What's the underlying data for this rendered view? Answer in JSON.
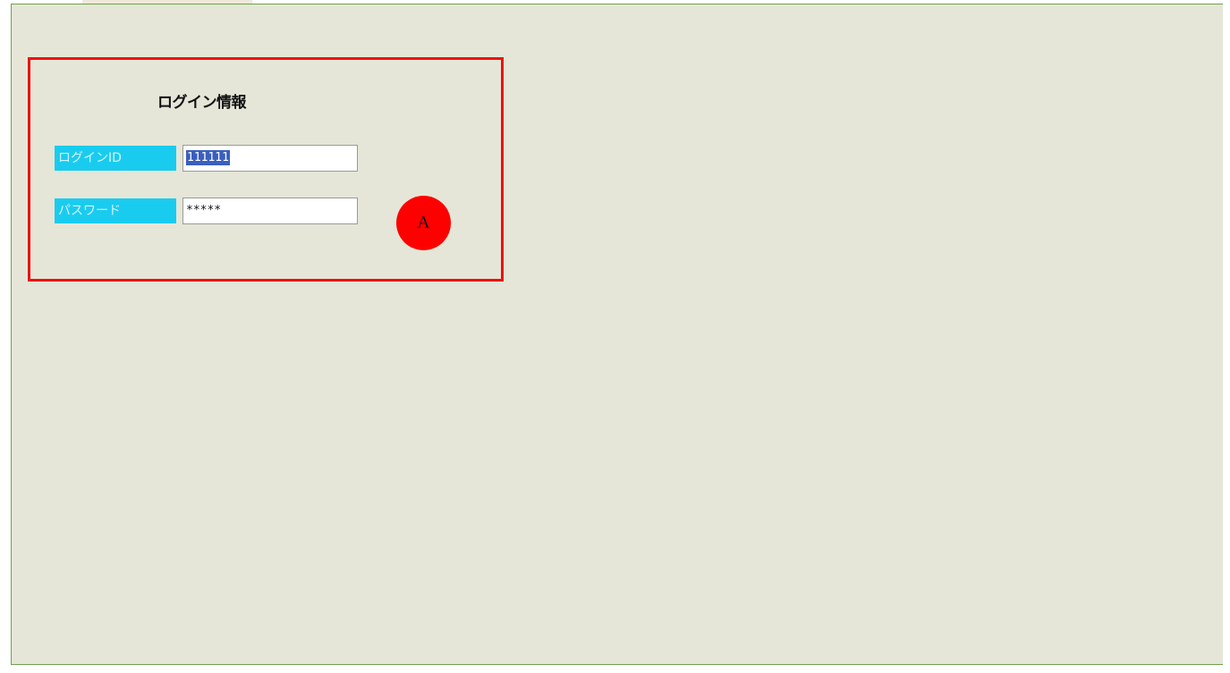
{
  "login_panel": {
    "title": "ログイン情報",
    "fields": [
      {
        "label": "ログインID",
        "value": "111111"
      },
      {
        "label": "パスワード",
        "value": "*****"
      }
    ]
  },
  "annotation": {
    "marker_label": "A",
    "marker_color": "#ff0000",
    "highlight_color": "#ee1111"
  },
  "colors": {
    "background": "#e5e6d7",
    "label_bg": "#19ccef",
    "border": "#6ea34a"
  }
}
